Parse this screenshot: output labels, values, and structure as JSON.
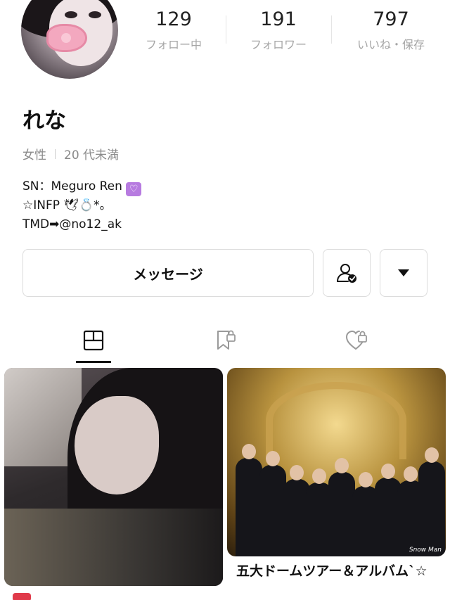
{
  "profile": {
    "name": "れな",
    "gender": "女性",
    "age": "20 代未満",
    "bio": {
      "line1_prefix": "SN：Meguro Ren",
      "line1_emoji": "♡",
      "line2": "☆INFP 🕊💍*。",
      "line3": "TMD➡@no12_ak"
    }
  },
  "stats": [
    {
      "value": "129",
      "label": "フォロー中"
    },
    {
      "value": "191",
      "label": "フォロワー"
    },
    {
      "value": "797",
      "label": "いいね・保存"
    }
  ],
  "actions": {
    "message_label": "メッセージ",
    "follow_icon": "person-check-icon",
    "more_icon": "caret-down-icon"
  },
  "tabs": [
    {
      "icon": "grid-icon",
      "active": true
    },
    {
      "icon": "bookmark-lock-icon",
      "active": false
    },
    {
      "icon": "heart-lock-icon",
      "active": false
    }
  ],
  "posts": [
    {
      "caption": ""
    },
    {
      "caption": "五大ドームツアー＆アルバム`☆",
      "image_text": "Snow Man"
    }
  ],
  "colors": {
    "label_gray": "#a6a6a6",
    "border": "#dcdcdc",
    "accent_heart": "#b77be0"
  }
}
